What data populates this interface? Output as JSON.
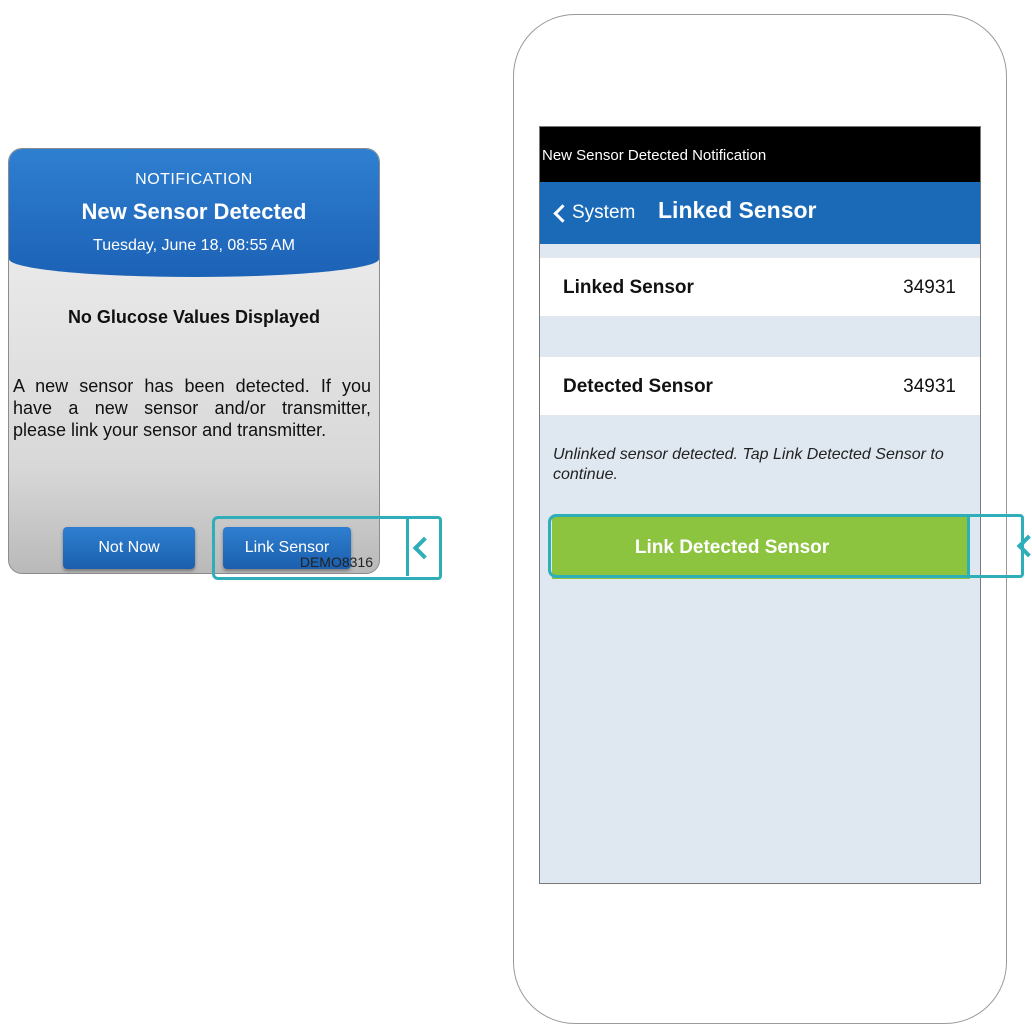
{
  "notification_card": {
    "label": "NOTIFICATION",
    "title": "New Sensor Detected",
    "datetime": "Tuesday, June 18, 08:55 AM",
    "alert": "No Glucose Values Displayed",
    "message": "A new sensor has been detected. If you have a new sensor and/or transmitter, please link your sensor and transmitter.",
    "buttons": {
      "not_now": "Not Now",
      "link_sensor": "Link Sensor"
    },
    "footer_code": "DEMO8316"
  },
  "phone": {
    "notification_banner": "New Sensor Detected Notification",
    "navbar": {
      "back_label": "System",
      "title": "Linked Sensor",
      "back_icon": "chevron-left-icon"
    },
    "rows": [
      {
        "label": "Linked Sensor",
        "value": "34931"
      },
      {
        "label": "Detected Sensor",
        "value": "34931"
      }
    ],
    "hint": "Unlinked sensor detected. Tap Link Detected Sensor to continue.",
    "primary_button": "Link Detected Sensor"
  },
  "highlight": {
    "color": "#2eaeb9",
    "icon": "chevron-left-icon"
  },
  "colors": {
    "header_blue": "#1b6ab8",
    "button_green": "#8cc33f"
  }
}
